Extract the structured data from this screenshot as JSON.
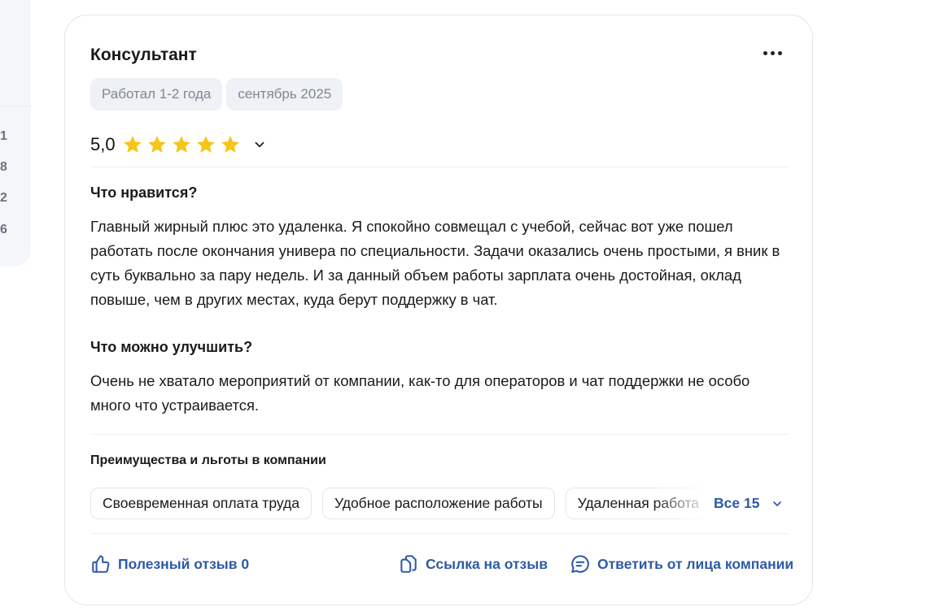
{
  "sidebar": {
    "numbers": [
      "1",
      "8",
      "2",
      "6"
    ]
  },
  "review": {
    "title": "Консультант",
    "tags": [
      "Работал 1-2 года",
      "сентябрь 2025"
    ],
    "rating": "5,0",
    "stars": 5,
    "likes_heading": "Что нравится?",
    "likes_text": "Главный жирный плюс это удаленка. Я спокойно совмещал с учебой, сейчас вот уже пошел работать после окончания универа по специальности. Задачи оказались очень простыми, я вник в суть буквально за пару недель. И за данный объем работы зарплата очень достойная, оклад повыше, чем в других местах, куда берут поддержку в чат.",
    "improve_heading": "Что можно улучшить?",
    "improve_text": "Очень не хватало мероприятий от компании, как-то для операторов и чат поддержки не особо много что устраивается.",
    "benefits_heading": "Преимущества и льготы в компании",
    "benefits": [
      "Своевременная оплата труда",
      "Удобное расположение работы",
      "Удаленная работа"
    ],
    "benefits_all": "Все 15",
    "actions": {
      "helpful": "Полезный отзыв 0",
      "link": "Ссылка на отзыв",
      "reply": "Ответить от лица компании"
    }
  },
  "colors": {
    "accent": "#2e5aa8",
    "star": "#f5c518",
    "tag_bg": "#eef1f6"
  }
}
